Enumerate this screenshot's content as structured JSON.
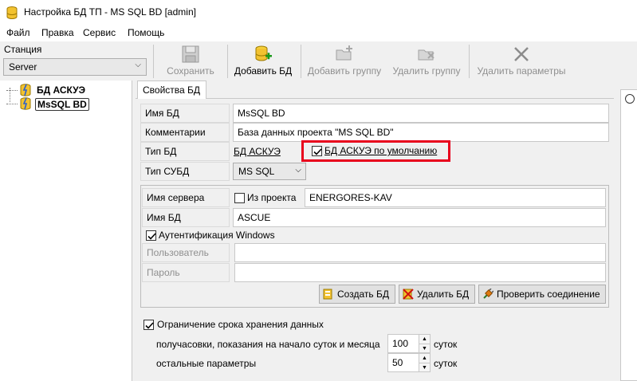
{
  "window": {
    "title": "Настройка БД ТП - MS SQL BD [admin]"
  },
  "menu": [
    "Файл",
    "Правка",
    "Сервис",
    "Помощь"
  ],
  "station": {
    "label": "Станция",
    "value": "Server"
  },
  "toolbar": {
    "save": "Сохранить",
    "add_db": "Добавить БД",
    "add_group": "Добавить группу",
    "delete_group": "Удалить группу",
    "delete_params": "Удалить параметры"
  },
  "tree": {
    "items": [
      "БД АСКУЭ",
      "MsSQL BD"
    ]
  },
  "tab": {
    "label": "Свойства БД"
  },
  "form": {
    "db_name_label": "Имя БД",
    "db_name_value": "MsSQL BD",
    "comment_label": "Комментарии",
    "comment_value": "База данных проекта \"MS SQL BD\"",
    "db_type_label": "Тип БД",
    "db_type_value": "БД АСКУЭ",
    "default_checkbox_label": "БД АСКУЭ по умолчанию",
    "dbms_type_label": "Тип СУБД",
    "dbms_type_value": "MS SQL"
  },
  "connection": {
    "server_label": "Имя сервера",
    "from_project_label": "Из проекта",
    "server_value": "ENERGORES-KAV",
    "db_label": "Имя БД",
    "db_value": "ASCUE",
    "win_auth_label": "Аутентификация Windows",
    "user_label": "Пользователь",
    "password_label": "Пароль",
    "create_btn": "Создать БД",
    "delete_btn": "Удалить БД",
    "check_btn": "Проверить соединение"
  },
  "retention": {
    "checkbox_label": "Ограничение срока хранения данных",
    "row1_label": "получасовки, показания на начало суток и месяца",
    "row1_value": "100",
    "row1_unit": "суток",
    "row2_label": "остальные параметры",
    "row2_value": "50",
    "row2_unit": "суток"
  },
  "colors": {
    "highlight": "#e8001c",
    "disabled_text": "#8f8f8f"
  }
}
